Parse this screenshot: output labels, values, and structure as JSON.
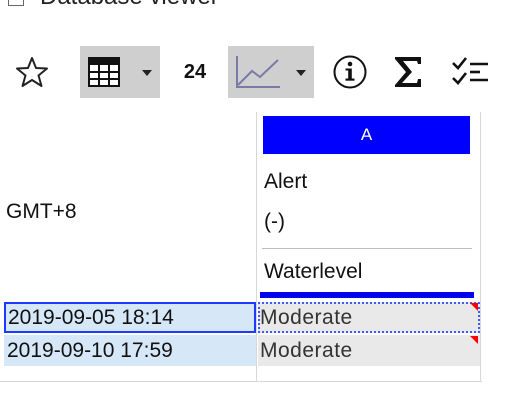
{
  "window": {
    "title": "Database viewer"
  },
  "toolbar": {
    "buttons": [
      {
        "name": "favorite",
        "icon": "star-outline-icon"
      },
      {
        "name": "table-view",
        "icon": "table-grid-icon",
        "pressed": true,
        "has_dropdown": true
      },
      {
        "name": "hours-range",
        "label": "24"
      },
      {
        "name": "chart-view",
        "icon": "line-chart-icon",
        "pressed": true,
        "has_dropdown": true
      },
      {
        "name": "info",
        "icon": "info-circle-icon"
      },
      {
        "name": "sum",
        "icon": "sigma-icon"
      },
      {
        "name": "checklist",
        "icon": "checklist-icon"
      }
    ]
  },
  "grid": {
    "timezone_label": "GMT+8",
    "column": {
      "letter": "A",
      "header_lines": [
        "Alert",
        "(-)",
        "Waterlevel"
      ]
    },
    "rows": [
      {
        "timestamp": "2019-09-05 18:14",
        "value": "Moderate",
        "selected": true
      },
      {
        "timestamp": "2019-09-10 17:59",
        "value": "Moderate",
        "selected": false
      }
    ]
  },
  "colors": {
    "header_letter_bg": "#0000ff",
    "date_cell_bg": "#d6e8f8",
    "value_cell_bg": "#e9e9e9",
    "selection_border": "#1a3cff",
    "flag_marker": "#ff0000"
  }
}
